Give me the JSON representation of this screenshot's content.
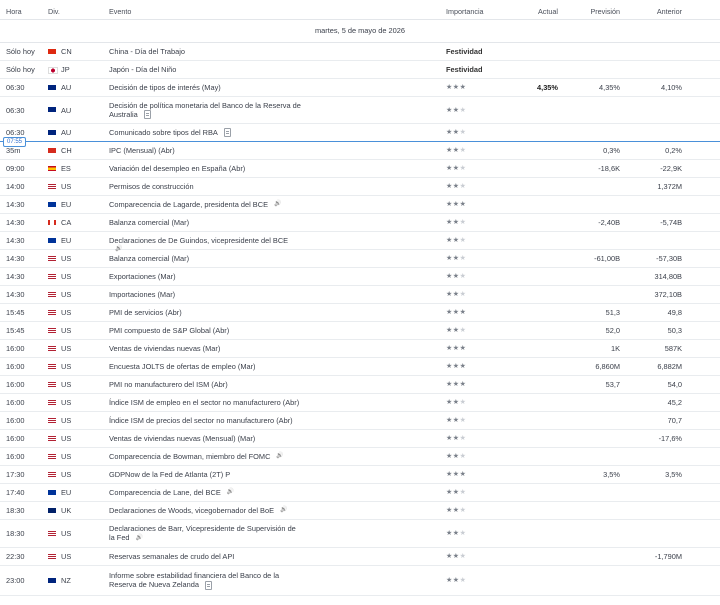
{
  "header": {
    "hora": "Hora",
    "div": "Div.",
    "evento": "Evento",
    "importancia": "Importancia",
    "actual": "Actual",
    "prevision": "Previsión",
    "anterior": "Anterior"
  },
  "date_label": "martes, 5 de mayo de 2026",
  "now_badge": "07:55",
  "colors": {
    "now_line": "#4a90d9",
    "star_on": "#7a808a",
    "star_off": "#c9cdd3"
  },
  "rows": [
    {
      "time": "Sólo hoy",
      "cur": "CN",
      "flag": "cn",
      "event": "China - Día del Trabajo",
      "holiday": "Festividad",
      "stars": 0,
      "actual": "",
      "forecast": "",
      "previous": "",
      "icon": ""
    },
    {
      "time": "Sólo hoy",
      "cur": "JP",
      "flag": "jp",
      "event": "Japón - Día del Niño",
      "holiday": "Festividad",
      "stars": 0,
      "actual": "",
      "forecast": "",
      "previous": "",
      "icon": ""
    },
    {
      "time": "06:30",
      "cur": "AU",
      "flag": "au",
      "event": "Decisión de tipos de interés  (May)",
      "holiday": "",
      "stars": 3,
      "actual": "4,35%",
      "forecast": "4,35%",
      "previous": "4,10%",
      "icon": ""
    },
    {
      "time": "06:30",
      "cur": "AU",
      "flag": "au",
      "event": "Decisión de política monetaria del Banco de la Reserva de Australia",
      "holiday": "",
      "stars": 2,
      "actual": "",
      "forecast": "",
      "previous": "",
      "icon": "doc"
    },
    {
      "time": "06:30",
      "cur": "AU",
      "flag": "au",
      "event": "Comunicado sobre tipos del RBA",
      "holiday": "",
      "stars": 2,
      "actual": "",
      "forecast": "",
      "previous": "",
      "icon": "doc"
    },
    {
      "time": "35m",
      "cur": "CH",
      "flag": "ch",
      "event": "IPC (Mensual)  (Abr)",
      "holiday": "",
      "stars": 2,
      "actual": "",
      "forecast": "0,3%",
      "previous": "0,2%",
      "icon": ""
    },
    {
      "time": "09:00",
      "cur": "ES",
      "flag": "es",
      "event": "Variación del desempleo en España  (Abr)",
      "holiday": "",
      "stars": 2,
      "actual": "",
      "forecast": "-18,6K",
      "previous": "-22,9K",
      "icon": ""
    },
    {
      "time": "14:00",
      "cur": "US",
      "flag": "us",
      "event": "Permisos de construcción",
      "holiday": "",
      "stars": 2,
      "actual": "",
      "forecast": "",
      "previous": "1,372M",
      "icon": ""
    },
    {
      "time": "14:30",
      "cur": "EU",
      "flag": "eu",
      "event": "Comparecencia de Lagarde, presidenta del BCE",
      "holiday": "",
      "stars": 3,
      "actual": "",
      "forecast": "",
      "previous": "",
      "icon": "audio"
    },
    {
      "time": "14:30",
      "cur": "CA",
      "flag": "ca",
      "event": "Balanza comercial  (Mar)",
      "holiday": "",
      "stars": 2,
      "actual": "",
      "forecast": "-2,40B",
      "previous": "-5,74B",
      "icon": ""
    },
    {
      "time": "14:30",
      "cur": "EU",
      "flag": "eu",
      "event": "Declaraciones de De Guindos, vicepresidente del BCE",
      "holiday": "",
      "stars": 2,
      "actual": "",
      "forecast": "",
      "previous": "",
      "icon": "audio"
    },
    {
      "time": "14:30",
      "cur": "US",
      "flag": "us",
      "event": "Balanza comercial  (Mar)",
      "holiday": "",
      "stars": 2,
      "actual": "",
      "forecast": "-61,00B",
      "previous": "-57,30B",
      "icon": ""
    },
    {
      "time": "14:30",
      "cur": "US",
      "flag": "us",
      "event": "Exportaciones  (Mar)",
      "holiday": "",
      "stars": 2,
      "actual": "",
      "forecast": "",
      "previous": "314,80B",
      "icon": ""
    },
    {
      "time": "14:30",
      "cur": "US",
      "flag": "us",
      "event": "Importaciones  (Mar)",
      "holiday": "",
      "stars": 2,
      "actual": "",
      "forecast": "",
      "previous": "372,10B",
      "icon": ""
    },
    {
      "time": "15:45",
      "cur": "US",
      "flag": "us",
      "event": "PMI de servicios  (Abr)",
      "holiday": "",
      "stars": 3,
      "actual": "",
      "forecast": "51,3",
      "previous": "49,8",
      "icon": ""
    },
    {
      "time": "15:45",
      "cur": "US",
      "flag": "us",
      "event": "PMI compuesto de S&P Global  (Abr)",
      "holiday": "",
      "stars": 2,
      "actual": "",
      "forecast": "52,0",
      "previous": "50,3",
      "icon": ""
    },
    {
      "time": "16:00",
      "cur": "US",
      "flag": "us",
      "event": "Ventas de viviendas nuevas  (Mar)",
      "holiday": "",
      "stars": 3,
      "actual": "",
      "forecast": "1K",
      "previous": "587K",
      "icon": ""
    },
    {
      "time": "16:00",
      "cur": "US",
      "flag": "us",
      "event": "Encuesta JOLTS de ofertas de empleo  (Mar)",
      "holiday": "",
      "stars": 3,
      "actual": "",
      "forecast": "6,860M",
      "previous": "6,882M",
      "icon": ""
    },
    {
      "time": "16:00",
      "cur": "US",
      "flag": "us",
      "event": "PMI no manufacturero del ISM  (Abr)",
      "holiday": "",
      "stars": 3,
      "actual": "",
      "forecast": "53,7",
      "previous": "54,0",
      "icon": ""
    },
    {
      "time": "16:00",
      "cur": "US",
      "flag": "us",
      "event": "Índice ISM de empleo en el sector no manufacturero  (Abr)",
      "holiday": "",
      "stars": 2,
      "actual": "",
      "forecast": "",
      "previous": "45,2",
      "icon": ""
    },
    {
      "time": "16:00",
      "cur": "US",
      "flag": "us",
      "event": "Índice ISM de precios del sector no manufacturero  (Abr)",
      "holiday": "",
      "stars": 2,
      "actual": "",
      "forecast": "",
      "previous": "70,7",
      "icon": ""
    },
    {
      "time": "16:00",
      "cur": "US",
      "flag": "us",
      "event": "Ventas de viviendas nuevas (Mensual)  (Mar)",
      "holiday": "",
      "stars": 2,
      "actual": "",
      "forecast": "",
      "previous": "-17,6%",
      "icon": ""
    },
    {
      "time": "16:00",
      "cur": "US",
      "flag": "us",
      "event": "Comparecencia de Bowman, miembro del FOMC",
      "holiday": "",
      "stars": 2,
      "actual": "",
      "forecast": "",
      "previous": "",
      "icon": "audio"
    },
    {
      "time": "17:30",
      "cur": "US",
      "flag": "us",
      "event": "GDPNow de la Fed de Atlanta  (2T)     P",
      "holiday": "",
      "stars": 3,
      "actual": "",
      "forecast": "3,5%",
      "previous": "3,5%",
      "icon": ""
    },
    {
      "time": "17:40",
      "cur": "EU",
      "flag": "eu",
      "event": "Comparecencia de Lane, del BCE",
      "holiday": "",
      "stars": 2,
      "actual": "",
      "forecast": "",
      "previous": "",
      "icon": "audio"
    },
    {
      "time": "18:30",
      "cur": "UK",
      "flag": "uk",
      "event": "Declaraciones de Woods, vicegobernador del BoE",
      "holiday": "",
      "stars": 2,
      "actual": "",
      "forecast": "",
      "previous": "",
      "icon": "audio"
    },
    {
      "time": "18:30",
      "cur": "US",
      "flag": "us",
      "event": "Declaraciones de Barr, Vicepresidente de Supervisión de la Fed",
      "holiday": "",
      "stars": 2,
      "actual": "",
      "forecast": "",
      "previous": "",
      "icon": "audio"
    },
    {
      "time": "22:30",
      "cur": "US",
      "flag": "us",
      "event": "Reservas semanales de crudo del API",
      "holiday": "",
      "stars": 2,
      "actual": "",
      "forecast": "",
      "previous": "-1,790M",
      "icon": ""
    },
    {
      "time": "23:00",
      "cur": "NZ",
      "flag": "nz",
      "event": "Informe sobre estabilidad financiera del Banco de la Reserva de Nueva Zelanda",
      "holiday": "",
      "stars": 2,
      "actual": "",
      "forecast": "",
      "previous": "",
      "icon": "doc"
    }
  ]
}
